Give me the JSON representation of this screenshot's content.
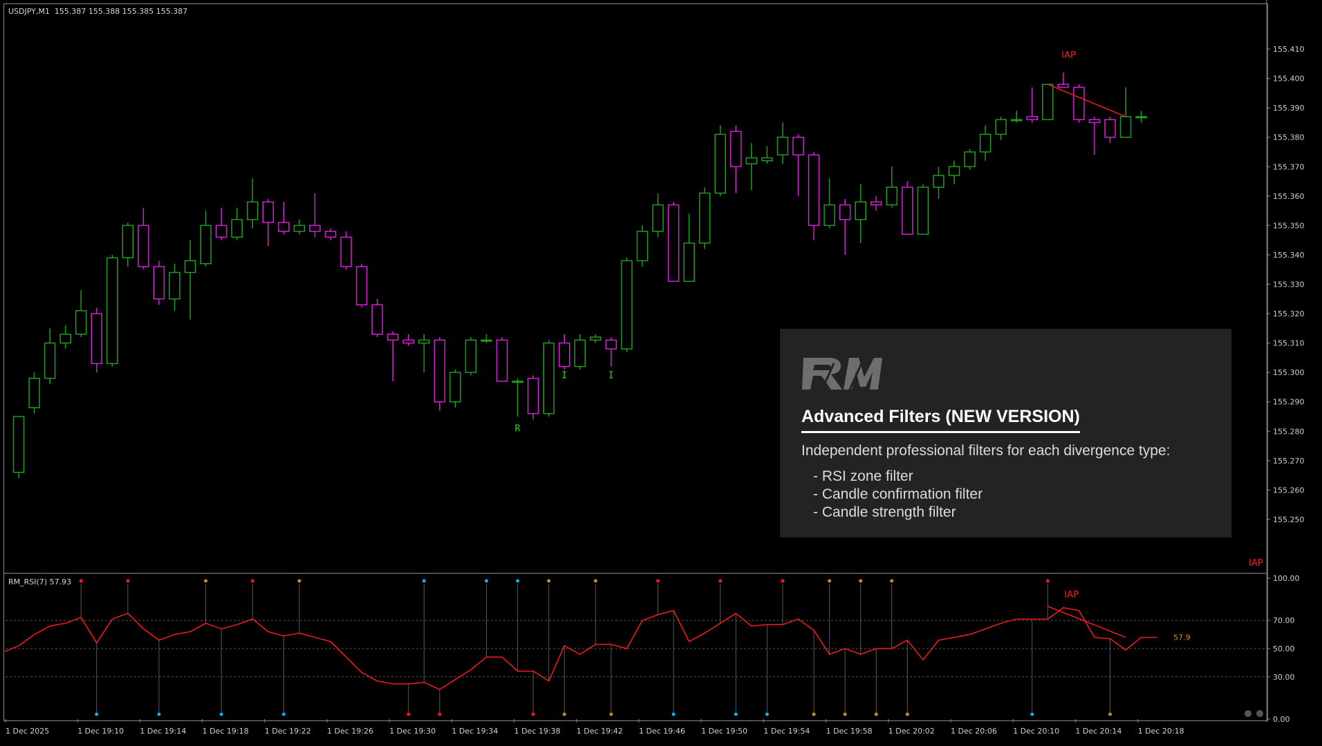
{
  "chart": {
    "header": "USDJPY,M1  155.387 155.388 155.385 155.387",
    "colors": {
      "bull": "#1f9e1f",
      "bear": "#d61fd6",
      "rsi_line": "#ff1a1a",
      "marker_red": "#ff1a1a",
      "marker_blue": "#00b4ff",
      "marker_orange": "#d08c1a"
    },
    "price_axis": {
      "min": 155.242,
      "max": 155.414,
      "ticks": [
        "155.410",
        "155.400",
        "155.390",
        "155.380",
        "155.370",
        "155.360",
        "155.350",
        "155.340",
        "155.330",
        "155.320",
        "155.310",
        "155.300",
        "155.290",
        "155.280",
        "155.270",
        "155.260",
        "155.250"
      ]
    },
    "candles": [
      {
        "o": 155.266,
        "h": 155.285,
        "l": 155.264,
        "c": 155.285
      },
      {
        "o": 155.288,
        "h": 155.3,
        "l": 155.286,
        "c": 155.298
      },
      {
        "o": 155.298,
        "h": 155.315,
        "l": 155.296,
        "c": 155.31
      },
      {
        "o": 155.31,
        "h": 155.316,
        "l": 155.308,
        "c": 155.313
      },
      {
        "o": 155.313,
        "h": 155.328,
        "l": 155.312,
        "c": 155.321
      },
      {
        "o": 155.32,
        "h": 155.322,
        "l": 155.3,
        "c": 155.303
      },
      {
        "o": 155.303,
        "h": 155.34,
        "l": 155.302,
        "c": 155.339
      },
      {
        "o": 155.339,
        "h": 155.351,
        "l": 155.336,
        "c": 155.35
      },
      {
        "o": 155.35,
        "h": 155.356,
        "l": 155.335,
        "c": 155.336
      },
      {
        "o": 155.336,
        "h": 155.338,
        "l": 155.323,
        "c": 155.325
      },
      {
        "o": 155.325,
        "h": 155.337,
        "l": 155.321,
        "c": 155.334
      },
      {
        "o": 155.334,
        "h": 155.345,
        "l": 155.318,
        "c": 155.338
      },
      {
        "o": 155.337,
        "h": 155.355,
        "l": 155.336,
        "c": 155.35
      },
      {
        "o": 155.35,
        "h": 155.356,
        "l": 155.345,
        "c": 155.346
      },
      {
        "o": 155.346,
        "h": 155.356,
        "l": 155.345,
        "c": 155.352
      },
      {
        "o": 155.352,
        "h": 155.366,
        "l": 155.349,
        "c": 155.358
      },
      {
        "o": 155.358,
        "h": 155.359,
        "l": 155.343,
        "c": 155.351
      },
      {
        "o": 155.351,
        "h": 155.358,
        "l": 155.347,
        "c": 155.348
      },
      {
        "o": 155.348,
        "h": 155.352,
        "l": 155.347,
        "c": 155.35
      },
      {
        "o": 155.35,
        "h": 155.361,
        "l": 155.346,
        "c": 155.348
      },
      {
        "o": 155.348,
        "h": 155.349,
        "l": 155.345,
        "c": 155.346
      },
      {
        "o": 155.346,
        "h": 155.348,
        "l": 155.335,
        "c": 155.336
      },
      {
        "o": 155.336,
        "h": 155.337,
        "l": 155.322,
        "c": 155.323
      },
      {
        "o": 155.323,
        "h": 155.325,
        "l": 155.312,
        "c": 155.313
      },
      {
        "o": 155.313,
        "h": 155.314,
        "l": 155.297,
        "c": 155.311
      },
      {
        "o": 155.311,
        "h": 155.313,
        "l": 155.309,
        "c": 155.31
      },
      {
        "o": 155.31,
        "h": 155.313,
        "l": 155.3,
        "c": 155.311
      },
      {
        "o": 155.311,
        "h": 155.312,
        "l": 155.287,
        "c": 155.29
      },
      {
        "o": 155.29,
        "h": 155.301,
        "l": 155.288,
        "c": 155.3
      },
      {
        "o": 155.3,
        "h": 155.312,
        "l": 155.299,
        "c": 155.311
      },
      {
        "o": 155.311,
        "h": 155.313,
        "l": 155.31,
        "c": 155.311
      },
      {
        "o": 155.311,
        "h": 155.312,
        "l": 155.297,
        "c": 155.297
      },
      {
        "o": 155.297,
        "h": 155.298,
        "l": 155.285,
        "c": 155.297
      },
      {
        "o": 155.298,
        "h": 155.299,
        "l": 155.284,
        "c": 155.286
      },
      {
        "o": 155.286,
        "h": 155.311,
        "l": 155.285,
        "c": 155.31
      },
      {
        "o": 155.31,
        "h": 155.313,
        "l": 155.301,
        "c": 155.302
      },
      {
        "o": 155.302,
        "h": 155.313,
        "l": 155.301,
        "c": 155.311
      },
      {
        "o": 155.311,
        "h": 155.313,
        "l": 155.31,
        "c": 155.312
      },
      {
        "o": 155.311,
        "h": 155.312,
        "l": 155.302,
        "c": 155.308
      },
      {
        "o": 155.308,
        "h": 155.339,
        "l": 155.307,
        "c": 155.338
      },
      {
        "o": 155.338,
        "h": 155.35,
        "l": 155.336,
        "c": 155.348
      },
      {
        "o": 155.348,
        "h": 155.361,
        "l": 155.346,
        "c": 155.357
      },
      {
        "o": 155.357,
        "h": 155.358,
        "l": 155.331,
        "c": 155.331
      },
      {
        "o": 155.331,
        "h": 155.354,
        "l": 155.331,
        "c": 155.344
      },
      {
        "o": 155.344,
        "h": 155.363,
        "l": 155.342,
        "c": 155.361
      },
      {
        "o": 155.361,
        "h": 155.384,
        "l": 155.36,
        "c": 155.381
      },
      {
        "o": 155.382,
        "h": 155.384,
        "l": 155.361,
        "c": 155.37
      },
      {
        "o": 155.371,
        "h": 155.378,
        "l": 155.362,
        "c": 155.373
      },
      {
        "o": 155.372,
        "h": 155.377,
        "l": 155.371,
        "c": 155.373
      },
      {
        "o": 155.374,
        "h": 155.385,
        "l": 155.371,
        "c": 155.38
      },
      {
        "o": 155.38,
        "h": 155.381,
        "l": 155.36,
        "c": 155.374
      },
      {
        "o": 155.374,
        "h": 155.375,
        "l": 155.345,
        "c": 155.35
      },
      {
        "o": 155.35,
        "h": 155.366,
        "l": 155.349,
        "c": 155.357
      },
      {
        "o": 155.357,
        "h": 155.359,
        "l": 155.34,
        "c": 155.352
      },
      {
        "o": 155.352,
        "h": 155.364,
        "l": 155.344,
        "c": 155.358
      },
      {
        "o": 155.358,
        "h": 155.36,
        "l": 155.355,
        "c": 155.357
      },
      {
        "o": 155.357,
        "h": 155.37,
        "l": 155.356,
        "c": 155.363
      },
      {
        "o": 155.363,
        "h": 155.365,
        "l": 155.347,
        "c": 155.347
      },
      {
        "o": 155.347,
        "h": 155.364,
        "l": 155.347,
        "c": 155.363
      },
      {
        "o": 155.363,
        "h": 155.37,
        "l": 155.359,
        "c": 155.367
      },
      {
        "o": 155.367,
        "h": 155.372,
        "l": 155.364,
        "c": 155.37
      },
      {
        "o": 155.37,
        "h": 155.376,
        "l": 155.369,
        "c": 155.375
      },
      {
        "o": 155.375,
        "h": 155.384,
        "l": 155.372,
        "c": 155.381
      },
      {
        "o": 155.381,
        "h": 155.387,
        "l": 155.379,
        "c": 155.386
      },
      {
        "o": 155.386,
        "h": 155.389,
        "l": 155.385,
        "c": 155.386
      },
      {
        "o": 155.387,
        "h": 155.397,
        "l": 155.385,
        "c": 155.386
      },
      {
        "o": 155.386,
        "h": 155.398,
        "l": 155.386,
        "c": 155.398
      },
      {
        "o": 155.398,
        "h": 155.402,
        "l": 155.397,
        "c": 155.397
      },
      {
        "o": 155.397,
        "h": 155.398,
        "l": 155.385,
        "c": 155.386
      },
      {
        "o": 155.386,
        "h": 155.387,
        "l": 155.374,
        "c": 155.385
      },
      {
        "o": 155.386,
        "h": 155.387,
        "l": 155.378,
        "c": 155.38
      },
      {
        "o": 155.38,
        "h": 155.397,
        "l": 155.38,
        "c": 155.387
      },
      {
        "o": 155.387,
        "h": 155.389,
        "l": 155.385,
        "c": 155.387
      }
    ],
    "price_divergence": {
      "label": "IAP",
      "from": {
        "bar": 66,
        "price": 155.398
      },
      "to": {
        "bar": 71,
        "price": 155.387
      }
    },
    "price_markers": [
      {
        "bar": 32,
        "text": "R",
        "price": 155.28
      },
      {
        "bar": 35,
        "text": "I",
        "price": 155.298
      },
      {
        "bar": 38,
        "text": "I",
        "price": 155.298
      }
    ],
    "corner_label": "IAP"
  },
  "rsi": {
    "header": "RM_RSI(7) 57.93",
    "current_value": "57.9",
    "levels": [
      70,
      50,
      30
    ],
    "axis_ticks": [
      "100.00",
      "70.00",
      "50.00",
      "30.00",
      "0.00"
    ],
    "values": [
      52,
      60,
      66,
      68,
      72,
      54,
      71,
      75,
      64,
      56,
      60,
      62,
      68,
      64,
      67,
      71,
      62,
      59,
      61,
      58,
      55,
      44,
      33,
      27,
      25,
      25,
      26,
      21,
      28,
      35,
      44,
      44,
      34,
      34,
      27,
      52,
      46,
      53,
      53,
      50,
      70,
      74,
      77,
      55,
      61,
      68,
      75,
      66,
      67,
      67,
      71,
      63,
      46,
      50,
      46,
      50,
      50,
      56,
      42,
      56,
      58,
      60,
      64,
      68,
      71,
      71,
      71,
      79,
      77,
      58,
      57,
      49,
      58,
      58
    ],
    "divergence": {
      "label": "IAP",
      "from": {
        "bar": 66,
        "value": 80
      },
      "to": {
        "bar": 71,
        "value": 58
      }
    },
    "dots_top": [
      {
        "bar": 4,
        "c": "marker_red"
      },
      {
        "bar": 7,
        "c": "marker_red"
      },
      {
        "bar": 12,
        "c": "marker_orange"
      },
      {
        "bar": 15,
        "c": "marker_red"
      },
      {
        "bar": 18,
        "c": "marker_orange"
      },
      {
        "bar": 26,
        "c": "marker_blue"
      },
      {
        "bar": 30,
        "c": "marker_blue"
      },
      {
        "bar": 32,
        "c": "marker_blue"
      },
      {
        "bar": 34,
        "c": "marker_orange"
      },
      {
        "bar": 37,
        "c": "marker_orange"
      },
      {
        "bar": 41,
        "c": "marker_red"
      },
      {
        "bar": 45,
        "c": "marker_red"
      },
      {
        "bar": 49,
        "c": "marker_red"
      },
      {
        "bar": 52,
        "c": "marker_orange"
      },
      {
        "bar": 54,
        "c": "marker_orange"
      },
      {
        "bar": 56,
        "c": "marker_orange"
      },
      {
        "bar": 66,
        "c": "marker_red"
      }
    ],
    "dots_bottom": [
      {
        "bar": 5,
        "c": "marker_blue"
      },
      {
        "bar": 9,
        "c": "marker_blue"
      },
      {
        "bar": 13,
        "c": "marker_blue"
      },
      {
        "bar": 17,
        "c": "marker_blue"
      },
      {
        "bar": 25,
        "c": "marker_red"
      },
      {
        "bar": 27,
        "c": "marker_red"
      },
      {
        "bar": 33,
        "c": "marker_red"
      },
      {
        "bar": 35,
        "c": "marker_orange"
      },
      {
        "bar": 38,
        "c": "marker_orange"
      },
      {
        "bar": 42,
        "c": "marker_blue"
      },
      {
        "bar": 46,
        "c": "marker_blue"
      },
      {
        "bar": 48,
        "c": "marker_blue"
      },
      {
        "bar": 51,
        "c": "marker_orange"
      },
      {
        "bar": 53,
        "c": "marker_orange"
      },
      {
        "bar": 55,
        "c": "marker_orange"
      },
      {
        "bar": 57,
        "c": "marker_orange"
      },
      {
        "bar": 65,
        "c": "marker_blue"
      },
      {
        "bar": 70,
        "c": "marker_orange"
      }
    ]
  },
  "time_axis": [
    {
      "bar": 0,
      "label": "1 Dec 2025"
    },
    {
      "bar": 4,
      "label": "1 Dec 19:10"
    },
    {
      "bar": 8,
      "label": "1 Dec 19:14"
    },
    {
      "bar": 12,
      "label": "1 Dec 19:18"
    },
    {
      "bar": 16,
      "label": "1 Dec 19:22"
    },
    {
      "bar": 20,
      "label": "1 Dec 19:26"
    },
    {
      "bar": 24,
      "label": "1 Dec 19:30"
    },
    {
      "bar": 28,
      "label": "1 Dec 19:34"
    },
    {
      "bar": 32,
      "label": "1 Dec 19:38"
    },
    {
      "bar": 36,
      "label": "1 Dec 19:42"
    },
    {
      "bar": 40,
      "label": "1 Dec 19:46"
    },
    {
      "bar": 44,
      "label": "1 Dec 19:50"
    },
    {
      "bar": 48,
      "label": "1 Dec 19:54"
    },
    {
      "bar": 52,
      "label": "1 Dec 19:58"
    },
    {
      "bar": 56,
      "label": "1 Dec 20:02"
    },
    {
      "bar": 60,
      "label": "1 Dec 20:06"
    },
    {
      "bar": 64,
      "label": "1 Dec 20:10"
    },
    {
      "bar": 68,
      "label": "1 Dec 20:14"
    },
    {
      "bar": 72,
      "label": "1 Dec 20:18"
    }
  ],
  "promo": {
    "title": "Advanced Filters (NEW VERSION)",
    "description": "Independent professional filters for each divergence type:",
    "items": [
      "- RSI zone filter",
      "- Candle confirmation filter",
      "- Candle strength filter"
    ],
    "logo_text": "RM"
  }
}
